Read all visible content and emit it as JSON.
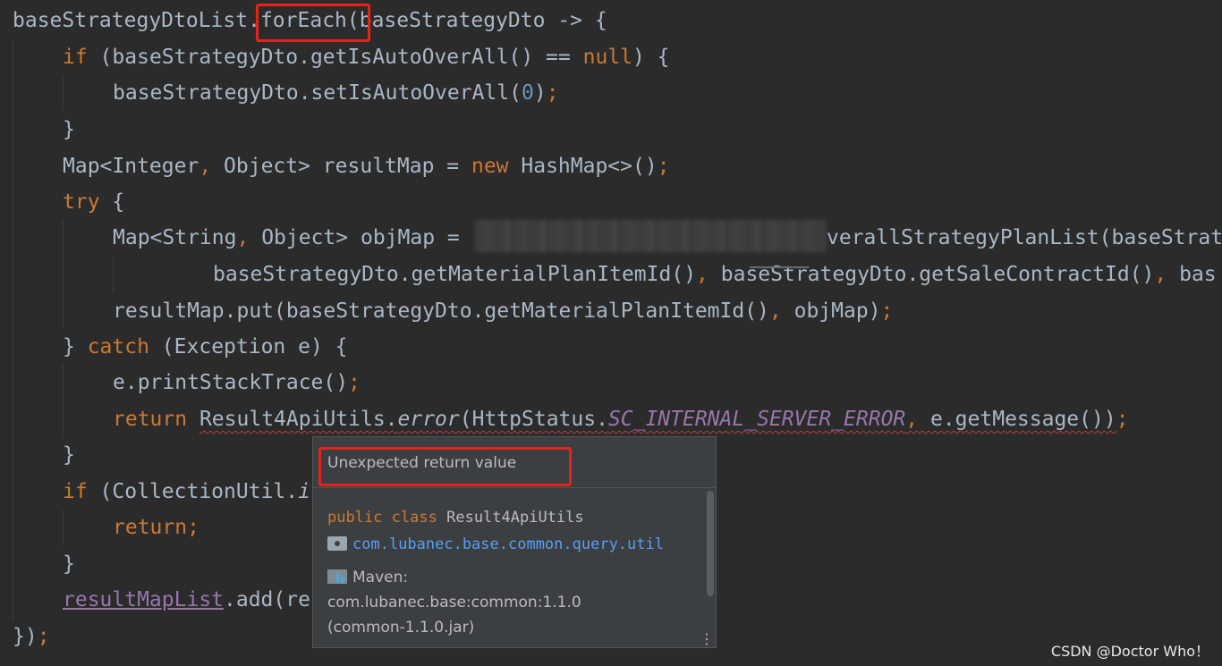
{
  "code_lines": [
    {
      "id": "l1",
      "text": "baseStrategyDtoList.forEach(baseStrategyDto -> {"
    },
    {
      "id": "l2",
      "text": "if (baseStrategyDto.getIsAutoOverAll() == null) {"
    },
    {
      "id": "l3",
      "text": "baseStrategyDto.setIsAutoOverAll(0);"
    },
    {
      "id": "l4",
      "text": "}"
    },
    {
      "id": "l5",
      "text": "Map<Integer, Object> resultMap = new HashMap<>();"
    },
    {
      "id": "l6",
      "text": "try {"
    },
    {
      "id": "l7",
      "text": "Map<String, Object> objMap =  verallStrategyPlanList(baseStrat"
    },
    {
      "id": "l8",
      "text": "baseStrategyDto.getMaterialPlanItemId(), baseStrategyDto.getSaleContractId(), bas"
    },
    {
      "id": "l9",
      "text": "resultMap.put(baseStrategyDto.getMaterialPlanItemId(), objMap);"
    },
    {
      "id": "l10",
      "text": "} catch (Exception e) {"
    },
    {
      "id": "l11",
      "text": "e.printStackTrace();"
    },
    {
      "id": "l12",
      "text": "return Result4ApiUtils.error(HttpStatus.SC_INTERNAL_SERVER_ERROR, e.getMessage());"
    },
    {
      "id": "l13",
      "text": "}"
    },
    {
      "id": "l14",
      "text": "if (CollectionUtil.i"
    },
    {
      "id": "l15",
      "text": "return;"
    },
    {
      "id": "l16",
      "text": "}"
    },
    {
      "id": "l17",
      "text": "resultMapList.add(re"
    },
    {
      "id": "l18",
      "text": "});"
    }
  ],
  "tokens": {
    "l1_a": "baseStrategyDtoList.",
    "l1_b": "forEach",
    "l1_c": "(baseStrategyDto -> {",
    "l2_if": "if",
    "l2_a": " (baseStrategyDto.getIsAutoOverAll() == ",
    "l2_null": "null",
    "l2_b": ") {",
    "l3_a": "baseStrategyDto.setIsAutoOverAll(",
    "l3_num": "0",
    "l3_b": ")",
    "l3_semi": ";",
    "l4": "}",
    "l5_a": "Map<Integer",
    "l5_comma": ",",
    "l5_b": " Object> resultMap = ",
    "l5_new": "new",
    "l5_c": " HashMap<>()",
    "l5_semi": ";",
    "l6_try": "try",
    "l6_a": " {",
    "l7_a": "Map<String",
    "l7_comma": ",",
    "l7_b": " Object> objMap = ",
    "l7_c": "verallStrategyPlanList(baseStrat",
    "l8_a": "baseStrategyDto.getMaterialPlanItemId()",
    "l8_comma1": ",",
    "l8_b": " baseStrategyDto.getSaleContractId()",
    "l8_comma2": ",",
    "l8_c": " bas",
    "l9_a": "resultMap.put(baseStrategyDto.getMaterialPlanItemId()",
    "l9_comma": ",",
    "l9_b": " objMap)",
    "l9_semi": ";",
    "l10_a": "} ",
    "l10_catch": "catch",
    "l10_b": " (Exception e) {",
    "l11_a": "e.printStackTrace()",
    "l11_semi": ";",
    "l12_return": "return",
    "l12_a": "Result4ApiUtils.",
    "l12_error": "error",
    "l12_b": "(HttpStatus.",
    "l12_const": "SC_INTERNAL_SERVER_ERROR",
    "l12_comma": ",",
    "l12_c": " e.getMessage())",
    "l12_semi": ";",
    "l13": "}",
    "l14_if": "if",
    "l14_a": " (CollectionUtil.",
    "l14_b": "i",
    "l15_return": "return",
    "l15_semi": ";",
    "l16": "}",
    "l17_a": "resultMapList",
    "l17_b": ".add(re",
    "l18_a": "})",
    "l18_semi": ";"
  },
  "popup": {
    "title": "Unexpected return value",
    "decl_kw1": "public",
    "decl_kw2": "class",
    "decl_name": "Result4ApiUtils",
    "package": "com.lubanec.base.common.query.util",
    "maven_label": "Maven:",
    "maven_coord": "com.lubanec.base:common:1.1.0",
    "maven_jar": "(common-1.1.0.jar)",
    "more_icon": "⋮"
  },
  "watermark": "CSDN @Doctor Who！",
  "icons": [
    "folder-icon",
    "library-icon",
    "more-options-icon"
  ],
  "colors": {
    "background": "#2b2b2b",
    "text": "#a9b7c6",
    "keyword": "#cc7832",
    "number": "#6897bb",
    "constant": "#9876aa",
    "link": "#589df6",
    "highlight_box": "#e8221b"
  }
}
